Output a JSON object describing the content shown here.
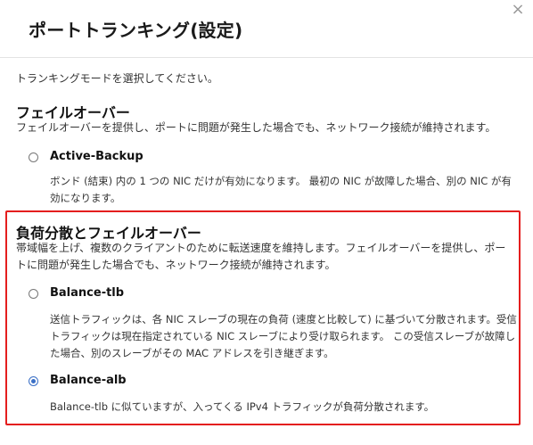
{
  "dialog": {
    "title": "ポートトランキング(設定)",
    "close_symbol": "×"
  },
  "intro": "トランキングモードを選択してください。",
  "failover": {
    "title": "フェイルオーバー",
    "description": "フェイルオーバーを提供し、ポートに問題が発生した場合でも、ネットワーク接続が維持されます。",
    "option": {
      "label": "Active-Backup",
      "selected": false,
      "description": "ボンド (結束) 内の 1 つの NIC だけが有効になります。 最初の NIC が故障した場合、別の NIC が有効になります。"
    }
  },
  "load_balance": {
    "title": "負荷分散とフェイルオーバー",
    "description": "帯域幅を上げ、複数のクライアントのために転送速度を維持します。フェイルオーバーを提供し、ポートに問題が発生した場合でも、ネットワーク接続が維持されます。",
    "options": [
      {
        "label": "Balance-tlb",
        "selected": false,
        "description": "送信トラフィックは、各 NIC スレーブの現在の負荷 (速度と比較して) に基づいて分散されます。受信トラフィックは現在指定されている NIC スレーブにより受け取られます。 この受信スレーブが故障した場合、別のスレーブがその MAC アドレスを引き継ぎます。"
      },
      {
        "label": "Balance-alb",
        "selected": true,
        "description": "Balance-tlb に似ていますが、入ってくる IPv4 トラフィックが負荷分散されます。"
      }
    ]
  },
  "colors": {
    "highlight_border": "#e41e1e",
    "radio_checked": "#3a6fc6"
  }
}
